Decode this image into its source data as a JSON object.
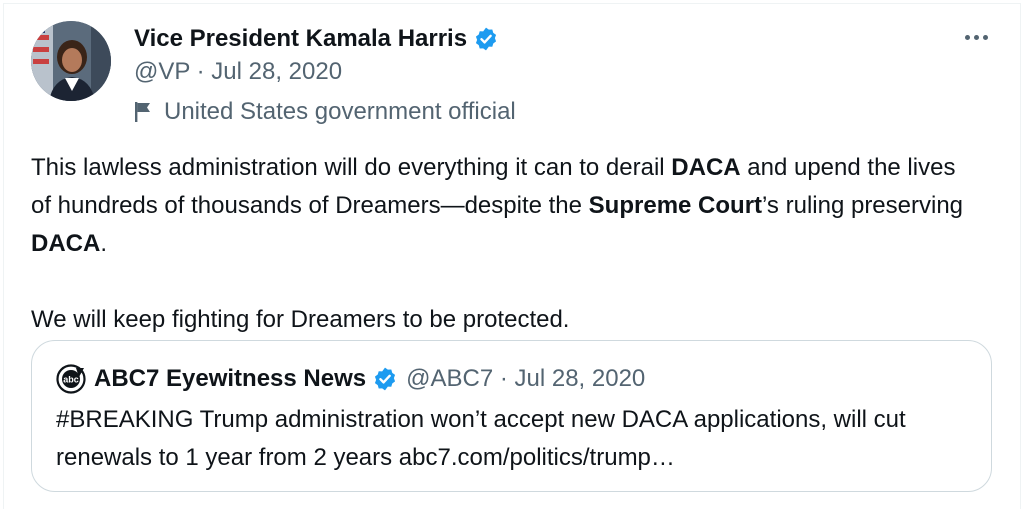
{
  "author": {
    "display_name": "Vice President Kamala Harris",
    "handle_date": "@VP · Jul 28, 2020",
    "label": "United States government official",
    "verified_color": "#1d9bf0"
  },
  "more_icon": "more-horizontal-icon",
  "tweet": {
    "line1_a": "This lawless administration will do everything it can to derail ",
    "line1_b": "DACA",
    "line1_c": " and upend the lives of hundreds of thousands of Dreamers—despite the ",
    "line1_d": "Supreme Court",
    "line1_e": "’s ruling preserving ",
    "line1_f": "DACA",
    "line1_g": ".",
    "line2": "We will keep fighting for Dreamers to be protected."
  },
  "quote": {
    "display_name": "ABC7 Eyewitness News",
    "handle_date": "@ABC7 · Jul 28, 2020",
    "text": "#BREAKING Trump administration won’t accept new DACA applications, will cut renewals to 1 year from 2 years abc7.com/politics/trump…",
    "logo_icon": "abc7-logo-icon"
  }
}
